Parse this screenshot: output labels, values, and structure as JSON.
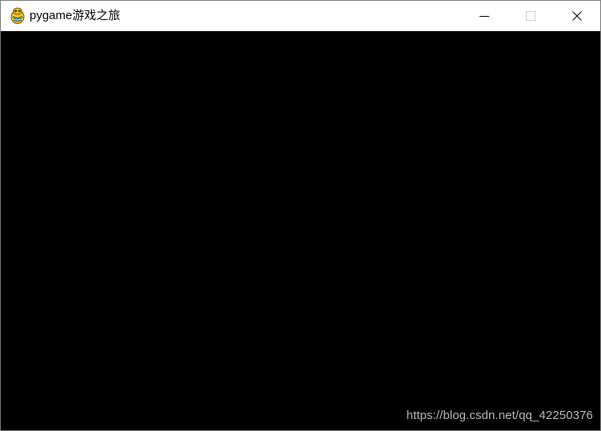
{
  "window": {
    "title": "pygame游戏之旅",
    "app_icon": "pygame-snake-icon",
    "controls": {
      "minimize_icon": "minimize-icon",
      "maximize_icon": "maximize-icon",
      "close_icon": "close-icon",
      "maximize_enabled": false
    }
  },
  "canvas": {
    "background_color": "#000000"
  },
  "watermark": {
    "text": "https://blog.csdn.net/qq_42250376"
  },
  "colors": {
    "titlebar_bg": "#ffffff",
    "title_text": "#000000",
    "watermark_text": "#bdbdbd",
    "disabled_control": "#c8c8c8"
  }
}
